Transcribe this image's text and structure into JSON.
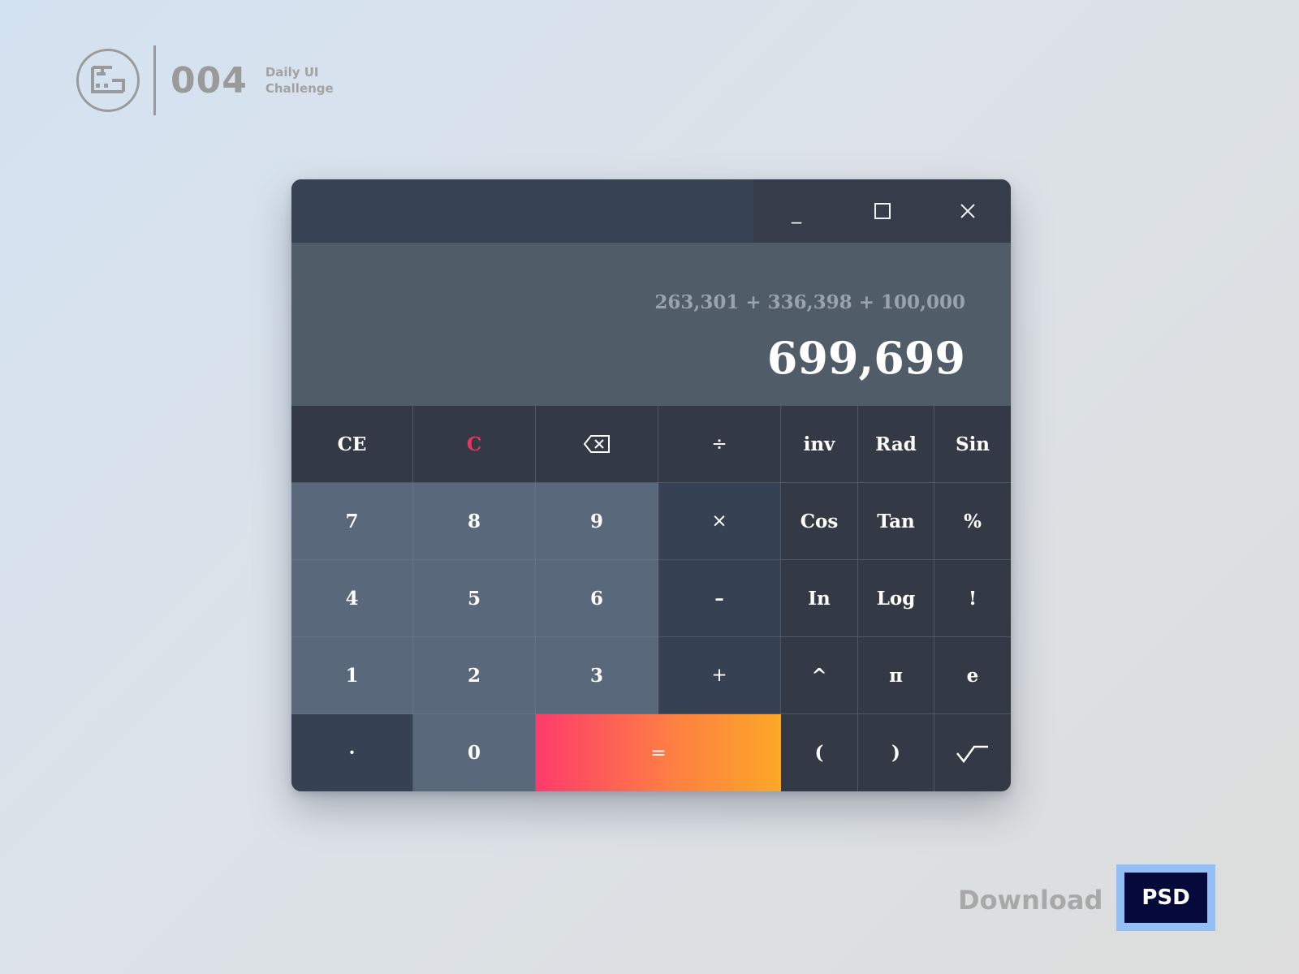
{
  "branding": {
    "logo_icon": "monitor-frame-logo",
    "number": "004",
    "tag_line1": "Daily UI",
    "tag_line2": "Challenge"
  },
  "window": {
    "controls": {
      "minimize_label": "_",
      "maximize_icon": "square-icon",
      "close_icon": "close-icon"
    }
  },
  "display": {
    "expression": "263,301 + 336,398 + 100,000",
    "result": "699,699"
  },
  "keys": {
    "ce": "CE",
    "c": "C",
    "backspace_icon": "backspace-icon",
    "divide": "÷",
    "inv": "inv",
    "rad": "Rad",
    "sin": "Sin",
    "seven": "7",
    "eight": "8",
    "nine": "9",
    "multiply": "×",
    "cos": "Cos",
    "tan": "Tan",
    "percent": "%",
    "four": "4",
    "five": "5",
    "six": "6",
    "minus": "–",
    "ln": "In",
    "log": "Log",
    "factorial": "!",
    "one": "1",
    "two": "2",
    "three": "3",
    "plus": "+",
    "power": "^",
    "pi": "π",
    "e": "e",
    "decimal": "·",
    "zero": "0",
    "equals": "=",
    "paren_open": "(",
    "paren_close": ")",
    "sqrt_icon": "square-root-icon"
  },
  "colors": {
    "accent_c": "#e8365f",
    "equals_gradient_start": "#fe3b6c",
    "equals_gradient_end": "#fba827",
    "psd_badge": "#050a3a"
  },
  "footer": {
    "download_label": "Download",
    "psd_label": "PSD"
  }
}
